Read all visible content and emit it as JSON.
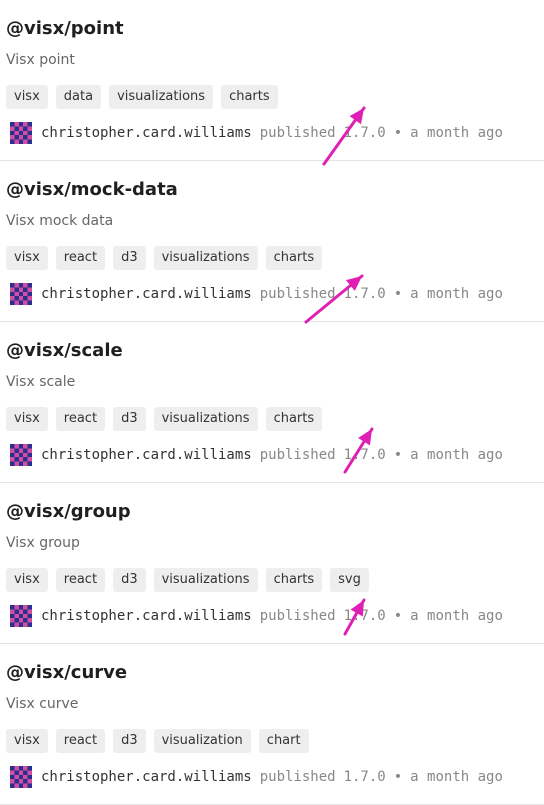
{
  "packages": [
    {
      "name": "@visx/point",
      "description": "Visx point",
      "keywords": [
        "visx",
        "data",
        "visualizations",
        "charts"
      ],
      "publisher": "christopher.card.williams",
      "published_label": "published",
      "version": "1.7.0",
      "separator": "•",
      "time": "a month ago"
    },
    {
      "name": "@visx/mock-data",
      "description": "Visx mock data",
      "keywords": [
        "visx",
        "react",
        "d3",
        "visualizations",
        "charts"
      ],
      "publisher": "christopher.card.williams",
      "published_label": "published",
      "version": "1.7.0",
      "separator": "•",
      "time": "a month ago"
    },
    {
      "name": "@visx/scale",
      "description": "Visx scale",
      "keywords": [
        "visx",
        "react",
        "d3",
        "visualizations",
        "charts"
      ],
      "publisher": "christopher.card.williams",
      "published_label": "published",
      "version": "1.7.0",
      "separator": "•",
      "time": "a month ago"
    },
    {
      "name": "@visx/group",
      "description": "Visx group",
      "keywords": [
        "visx",
        "react",
        "d3",
        "visualizations",
        "charts",
        "svg"
      ],
      "publisher": "christopher.card.williams",
      "published_label": "published",
      "version": "1.7.0",
      "separator": "•",
      "time": "a month ago"
    },
    {
      "name": "@visx/curve",
      "description": "Visx curve",
      "keywords": [
        "visx",
        "react",
        "d3",
        "visualization",
        "chart"
      ],
      "publisher": "christopher.card.williams",
      "published_label": "published",
      "version": "1.7.0",
      "separator": "•",
      "time": "a month ago"
    }
  ],
  "icons": {
    "avatar": "identicon-avatar-icon",
    "annotation": "arrow-pointer-icon"
  },
  "colors": {
    "annotation_arrow": "#e020b4",
    "avatar_primary": "#2b2f8f",
    "avatar_secondary": "#d24fa0"
  }
}
